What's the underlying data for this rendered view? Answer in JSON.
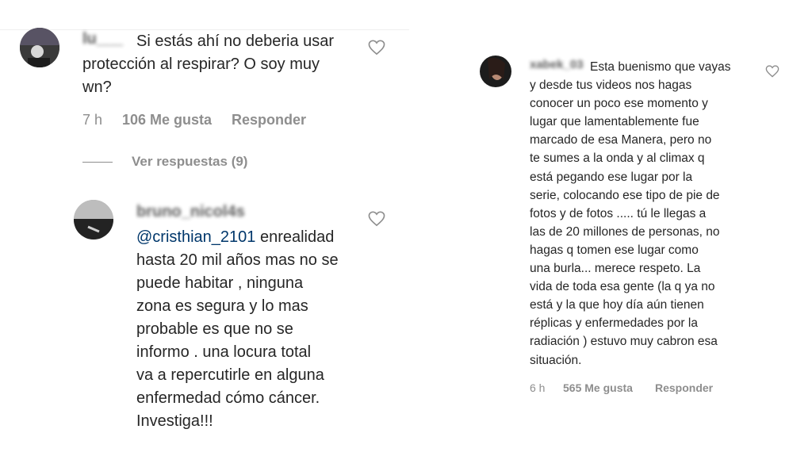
{
  "left": {
    "comment1": {
      "username": "lu___",
      "text_line1_rest": "Si estás ahí no deberia usar",
      "text_line2": "protección al respirar? O soy muy",
      "text_line3": "wn?",
      "time": "7 h",
      "likes": "106 Me gusta",
      "reply": "Responder",
      "view_replies": "Ver respuestas (9)"
    },
    "comment2": {
      "username": "bruno_nicol4s",
      "mention": "@cristhian_2101",
      "lines": [
        "enrealidad",
        "hasta 20 mil años mas no se",
        "puede habitar , ninguna",
        "zona es segura y lo mas",
        "probable es que no se",
        "informo . una locura total",
        "va a repercutirle en alguna",
        "enfermedad cómo cáncer.",
        "Investiga!!!"
      ]
    }
  },
  "right": {
    "comment": {
      "username": "xabek_03",
      "lines": [
        "Esta buenismo que vayas",
        "y desde tus videos nos hagas",
        "conocer un poco ese momento y",
        "lugar que lamentablemente fue",
        "marcado de esa Manera, pero no",
        "te sumes a la onda y al climax q",
        "está pegando ese lugar por la",
        "serie, colocando ese tipo de pie de",
        "fotos y de fotos ..... tú le llegas a",
        "las de 20 millones de personas, no",
        "hagas q tomen ese lugar como",
        "una burla... merece respeto. La",
        "vida de toda esa gente (la q ya no",
        "está y la que hoy día aún tienen",
        "réplicas y enfermedades por la",
        "radiación ) estuvo muy cabron esa",
        "situación."
      ],
      "time": "6 h",
      "likes": "565 Me gusta",
      "reply": "Responder"
    }
  },
  "icons": {
    "like": "heart-outline-icon"
  }
}
